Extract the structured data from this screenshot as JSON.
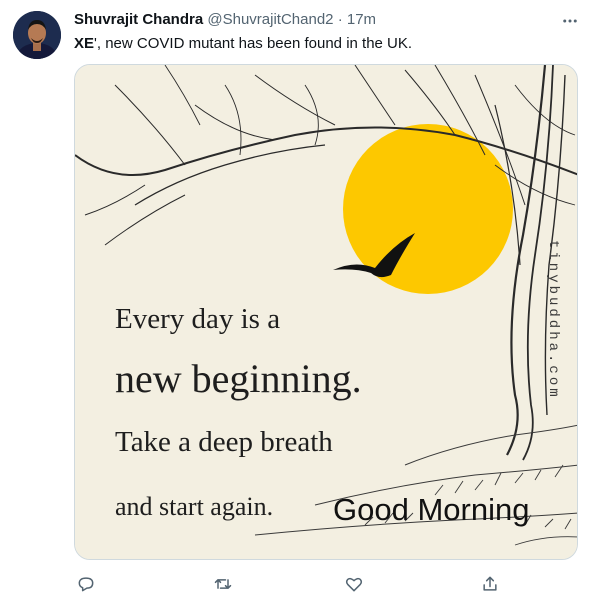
{
  "tweet": {
    "author_name": "Shuvrajit Chandra",
    "handle": "@ShuvrajitChand2",
    "separator": "·",
    "time": "17m",
    "text_bold": "XE",
    "text_rest": "', new COVID mutant has been found in the UK."
  },
  "image": {
    "quote_line1": "Every day is a",
    "quote_line2": "new beginning.",
    "quote_line3": "Take a deep breath",
    "quote_line4": "and start again.",
    "overlay_text": "Good Morning",
    "watermark": "tinybuddha.com",
    "sun_color": "#fdc800",
    "background_color": "#f3efe1"
  },
  "actions": {
    "icons": [
      "reply-icon",
      "retweet-icon",
      "like-icon",
      "share-icon"
    ]
  },
  "colors": {
    "text": "#0f1419",
    "secondary": "#536471",
    "border": "#cfd9de"
  }
}
